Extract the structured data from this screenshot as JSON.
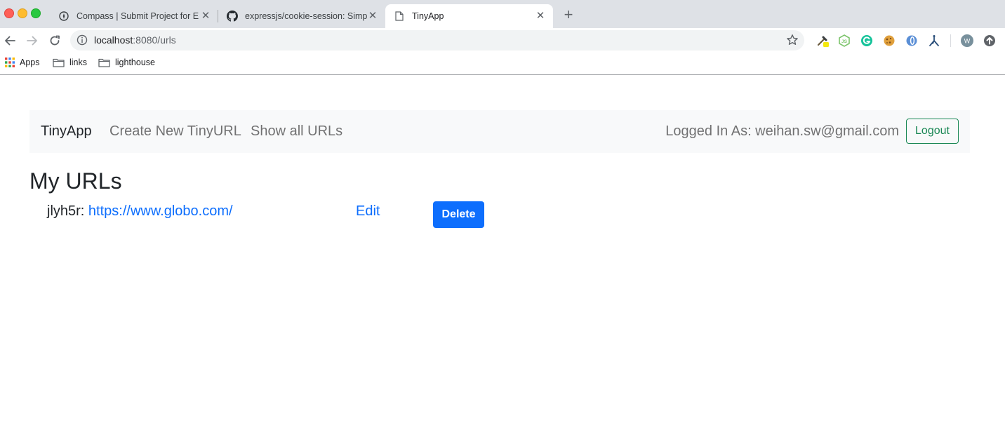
{
  "browser": {
    "tabs": [
      {
        "title": "Compass | Submit Project for E",
        "icon": "compass-icon"
      },
      {
        "title": "expressjs/cookie-session: Simp",
        "icon": "github-icon"
      },
      {
        "title": "TinyApp",
        "icon": "page-icon",
        "active": true
      }
    ],
    "address": {
      "host": "localhost",
      "path": ":8080/urls"
    },
    "bookmarks": [
      {
        "label": "Apps",
        "icon": "apps-grid-icon"
      },
      {
        "label": "links",
        "icon": "folder-icon"
      },
      {
        "label": "lighthouse",
        "icon": "folder-icon"
      }
    ],
    "profile_initial": "W"
  },
  "navbar": {
    "brand": "TinyApp",
    "links": [
      "Create New TinyURL",
      "Show all URLs"
    ],
    "logged_in_text": "Logged In As: weihan.sw@gmail.com",
    "logout_label": "Logout"
  },
  "page": {
    "heading": "My URLs",
    "urls": [
      {
        "short": "jlyh5r:",
        "long": "https://www.globo.com/",
        "edit_label": "Edit",
        "delete_label": "Delete"
      }
    ]
  },
  "colors": {
    "link": "#0d6efd",
    "delete_button": "#0d6efd",
    "logout_outline": "#198754",
    "navbar_bg": "#f8f9fa"
  }
}
